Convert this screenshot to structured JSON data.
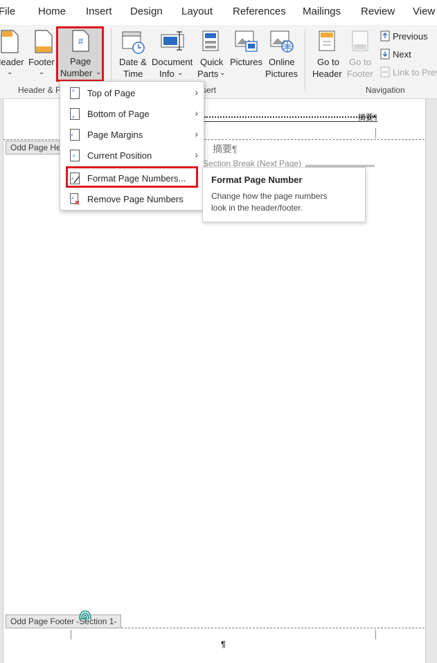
{
  "tabs": [
    "File",
    "Home",
    "Insert",
    "Design",
    "Layout",
    "References",
    "Mailings",
    "Review",
    "View"
  ],
  "ribbon": {
    "header_button": "Header",
    "footer_button": "Footer",
    "page_number_button": [
      "Page",
      "Number"
    ],
    "date_time_button": [
      "Date &",
      "Time"
    ],
    "document_info_button": [
      "Document",
      "Info"
    ],
    "quick_parts_button": [
      "Quick",
      "Parts"
    ],
    "pictures_button": "Pictures",
    "online_pictures_button": [
      "Online",
      "Pictures"
    ],
    "go_to_header_button": [
      "Go to",
      "Header"
    ],
    "go_to_footer_button": [
      "Go to",
      "Footer"
    ],
    "previous_button": "Previous",
    "next_button": "Next",
    "link_to_previous_button": "Link to Prev",
    "groups": {
      "header_footer": "Header & F",
      "insert": "sert",
      "navigation": "Navigation"
    }
  },
  "menu": {
    "items": [
      {
        "label": "Top of Page",
        "submenu": true
      },
      {
        "label": "Bottom of Page",
        "submenu": true
      },
      {
        "label": "Page Margins",
        "submenu": true
      },
      {
        "label": "Current Position",
        "submenu": true
      },
      {
        "label": "Format Page Numbers...",
        "submenu": false
      },
      {
        "label": "Remove Page Numbers",
        "submenu": false
      }
    ]
  },
  "tooltip": {
    "title": "Format Page Number",
    "body_line1": "Change how the page numbers",
    "body_line2": "look in the header/footer."
  },
  "document": {
    "header_text": "摘要¶",
    "header_tag": "Odd Page He",
    "body_heading": "摘要¶",
    "section_break": "Section Break (Next Page)",
    "footer_tag": "Odd Page Footer -Section 1-",
    "footer_mark": "¶"
  },
  "colors": {
    "highlight_red": "#e0141e",
    "ribbon_bg": "#f3f3f3"
  }
}
